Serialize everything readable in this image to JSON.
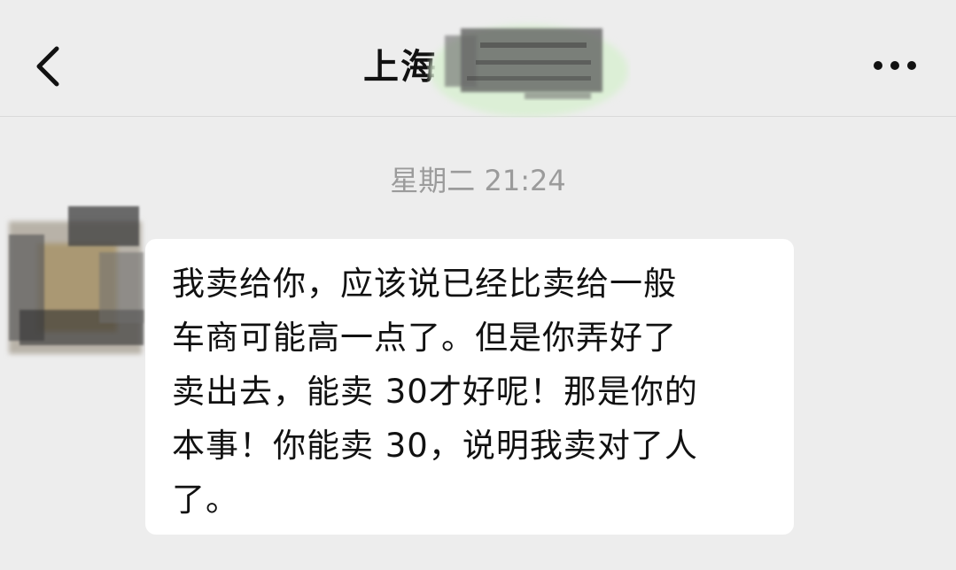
{
  "header": {
    "back_icon": "chevron-left-icon",
    "title": "上海",
    "more_icon": "more-horizontal-icon"
  },
  "chat": {
    "timestamp": "星期二 21:24",
    "messages": [
      {
        "sender": "contact",
        "text": "我卖给你，应该说已经比卖给一般\n车商可能高一点了。但是你弄好了\n卖出去，能卖 30才好呢！那是你的\n本事！你能卖 30，说明我卖对了人\n了。"
      }
    ]
  },
  "colors": {
    "background": "#ededed",
    "bubble": "#ffffff",
    "text": "#111111",
    "timestamp": "#9b9b9b"
  }
}
